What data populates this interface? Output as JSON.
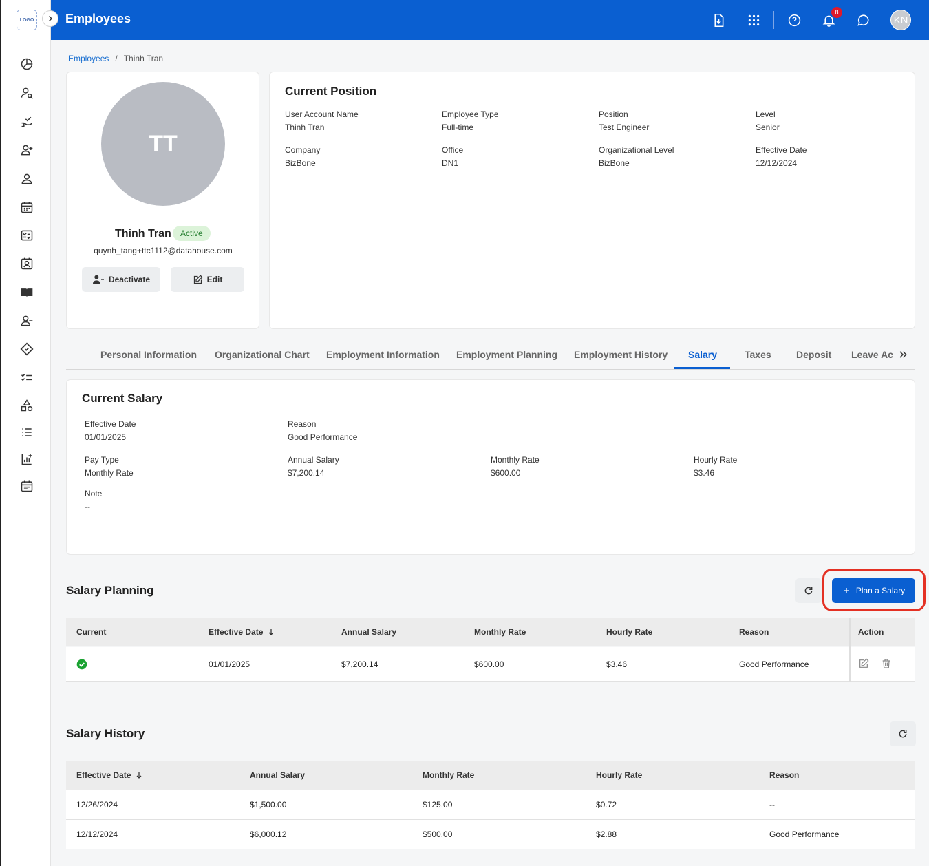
{
  "app": {
    "title": "Employees",
    "logo_text": "LOGO",
    "notification_count": "8",
    "user_initials": "KN"
  },
  "breadcrumb": {
    "parent": "Employees",
    "separator": "/",
    "current": "Thinh Tran"
  },
  "profile": {
    "initials": "TT",
    "name": "Thinh Tran",
    "status": "Active",
    "email": "quynh_tang+ttc1112@datahouse.com",
    "deactivate_label": "Deactivate",
    "edit_label": "Edit"
  },
  "current_position": {
    "title": "Current Position",
    "fields": [
      {
        "label": "User Account Name",
        "value": "Thinh Tran"
      },
      {
        "label": "Employee Type",
        "value": "Full-time"
      },
      {
        "label": "Position",
        "value": "Test Engineer"
      },
      {
        "label": "Level",
        "value": "Senior"
      },
      {
        "label": "Company",
        "value": "BizBone"
      },
      {
        "label": "Office",
        "value": "DN1"
      },
      {
        "label": "Organizational Level",
        "value": "BizBone"
      },
      {
        "label": "Effective Date",
        "value": "12/12/2024"
      }
    ]
  },
  "tabs": [
    "Personal Information",
    "Organizational Chart",
    "Employment Information",
    "Employment Planning",
    "Employment History",
    "Salary",
    "Taxes",
    "Deposit",
    "Leave Ac"
  ],
  "active_tab": "Salary",
  "current_salary": {
    "title": "Current Salary",
    "effective_date_label": "Effective Date",
    "effective_date": "01/01/2025",
    "reason_label": "Reason",
    "reason": "Good Performance",
    "pay_type_label": "Pay Type",
    "pay_type": "Monthly Rate",
    "annual_salary_label": "Annual Salary",
    "annual_salary": "$7,200.14",
    "monthly_rate_label": "Monthly Rate",
    "monthly_rate": "$600.00",
    "hourly_rate_label": "Hourly Rate",
    "hourly_rate": "$3.46",
    "note_label": "Note",
    "note": "--"
  },
  "salary_planning": {
    "title": "Salary Planning",
    "plan_button": "Plan a Salary",
    "columns": [
      "Current",
      "Effective Date",
      "Annual Salary",
      "Monthly Rate",
      "Hourly Rate",
      "Reason",
      "Action"
    ],
    "rows": [
      {
        "current": true,
        "effective_date": "01/01/2025",
        "annual_salary": "$7,200.14",
        "monthly_rate": "$600.00",
        "hourly_rate": "$3.46",
        "reason": "Good Performance"
      }
    ]
  },
  "salary_history": {
    "title": "Salary History",
    "columns": [
      "Effective Date",
      "Annual Salary",
      "Monthly Rate",
      "Hourly Rate",
      "Reason"
    ],
    "rows": [
      {
        "effective_date": "12/26/2024",
        "annual_salary": "$1,500.00",
        "monthly_rate": "$125.00",
        "hourly_rate": "$0.72",
        "reason": "--"
      },
      {
        "effective_date": "12/12/2024",
        "annual_salary": "$6,000.12",
        "monthly_rate": "$500.00",
        "hourly_rate": "$2.88",
        "reason": "Good Performance"
      }
    ]
  },
  "colors": {
    "primary": "#0a5fd1",
    "highlight": "#e43124",
    "success": "#1aa231",
    "badge_red": "#e0192b"
  }
}
